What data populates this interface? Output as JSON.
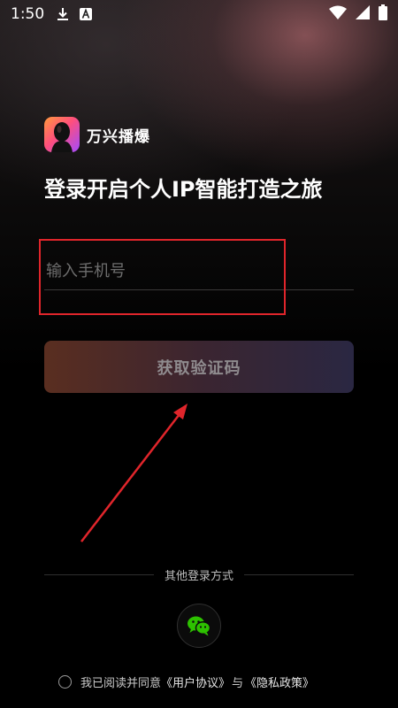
{
  "status_bar": {
    "time": "1:50",
    "icons": [
      "download-icon",
      "a-notification-icon",
      "wifi-icon",
      "signal-icon",
      "battery-icon"
    ]
  },
  "app": {
    "name": "万兴播爆",
    "logo_icon": "app-logo-icon"
  },
  "headline": "登录开启个人IP智能打造之旅",
  "phone_input": {
    "placeholder": "输入手机号",
    "value": ""
  },
  "get_code_button": {
    "label": "获取验证码"
  },
  "other_login": {
    "label": "其他登录方式",
    "wechat_icon": "wechat-icon"
  },
  "agreement": {
    "prefix": "我已阅读并同意",
    "user_agreement": "《用户协议》",
    "conjunction": "与",
    "privacy_policy": "《隐私政策》",
    "checked": false
  },
  "colors": {
    "annotation_red": "#e0252b",
    "wechat_green": "#2dc100",
    "button_gradient_start": "#5a2e20",
    "button_gradient_end": "#2a2742"
  }
}
